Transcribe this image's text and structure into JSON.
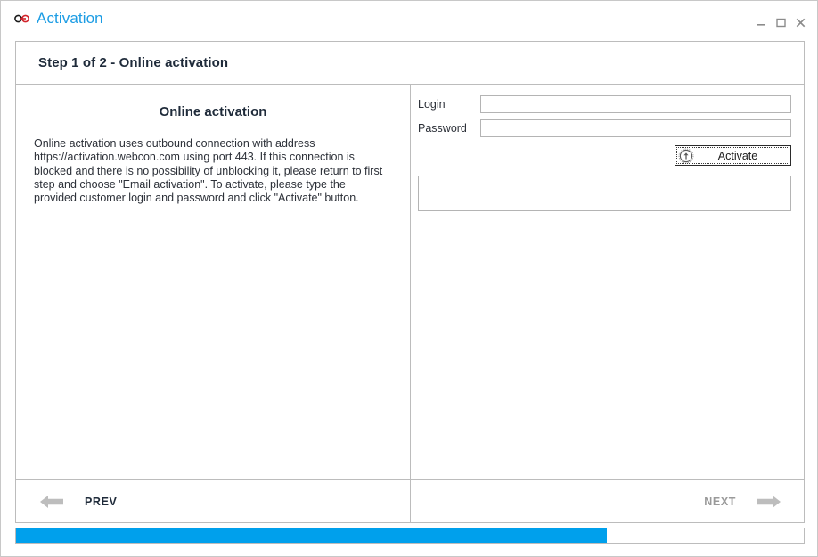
{
  "window": {
    "title": "Activation",
    "title_icon": "link-chain-icon",
    "controls": [
      {
        "name": "minimize-button",
        "glyph": "minimize-icon"
      },
      {
        "name": "maximize-button",
        "glyph": "maximize-icon"
      },
      {
        "name": "close-button",
        "glyph": "close-icon"
      }
    ]
  },
  "colors": {
    "accent": "#1b9ce4",
    "progress_fill": "#00a0ec",
    "heading": "#1f2b3a",
    "border": "#bcbcbc",
    "disabled_text": "#9a9a9a"
  },
  "step_header": {
    "title": "Step 1 of 2 - Online activation"
  },
  "left_pane": {
    "heading": "Online activation",
    "body": "Online activation uses outbound connection with address https://activation.webcon.com using port 443. If this connection is blocked and there is no possibility of unblocking it, please return to first step and choose \"Email activation\". To activate, please type the provided customer login and password and click \"Activate\" button."
  },
  "right_pane": {
    "login": {
      "label": "Login",
      "value": "",
      "placeholder": ""
    },
    "password": {
      "label": "Password",
      "value": "",
      "placeholder": ""
    },
    "activate_button": {
      "label": "Activate",
      "icon": "activate-arrow-up-circle-icon",
      "focused": true
    },
    "status_box": {
      "text": ""
    }
  },
  "footer": {
    "prev": {
      "label": "PREV",
      "icon": "arrow-left-icon",
      "enabled": true
    },
    "next": {
      "label": "NEXT",
      "icon": "arrow-right-icon",
      "enabled": false
    }
  },
  "progress": {
    "percent": 75
  }
}
